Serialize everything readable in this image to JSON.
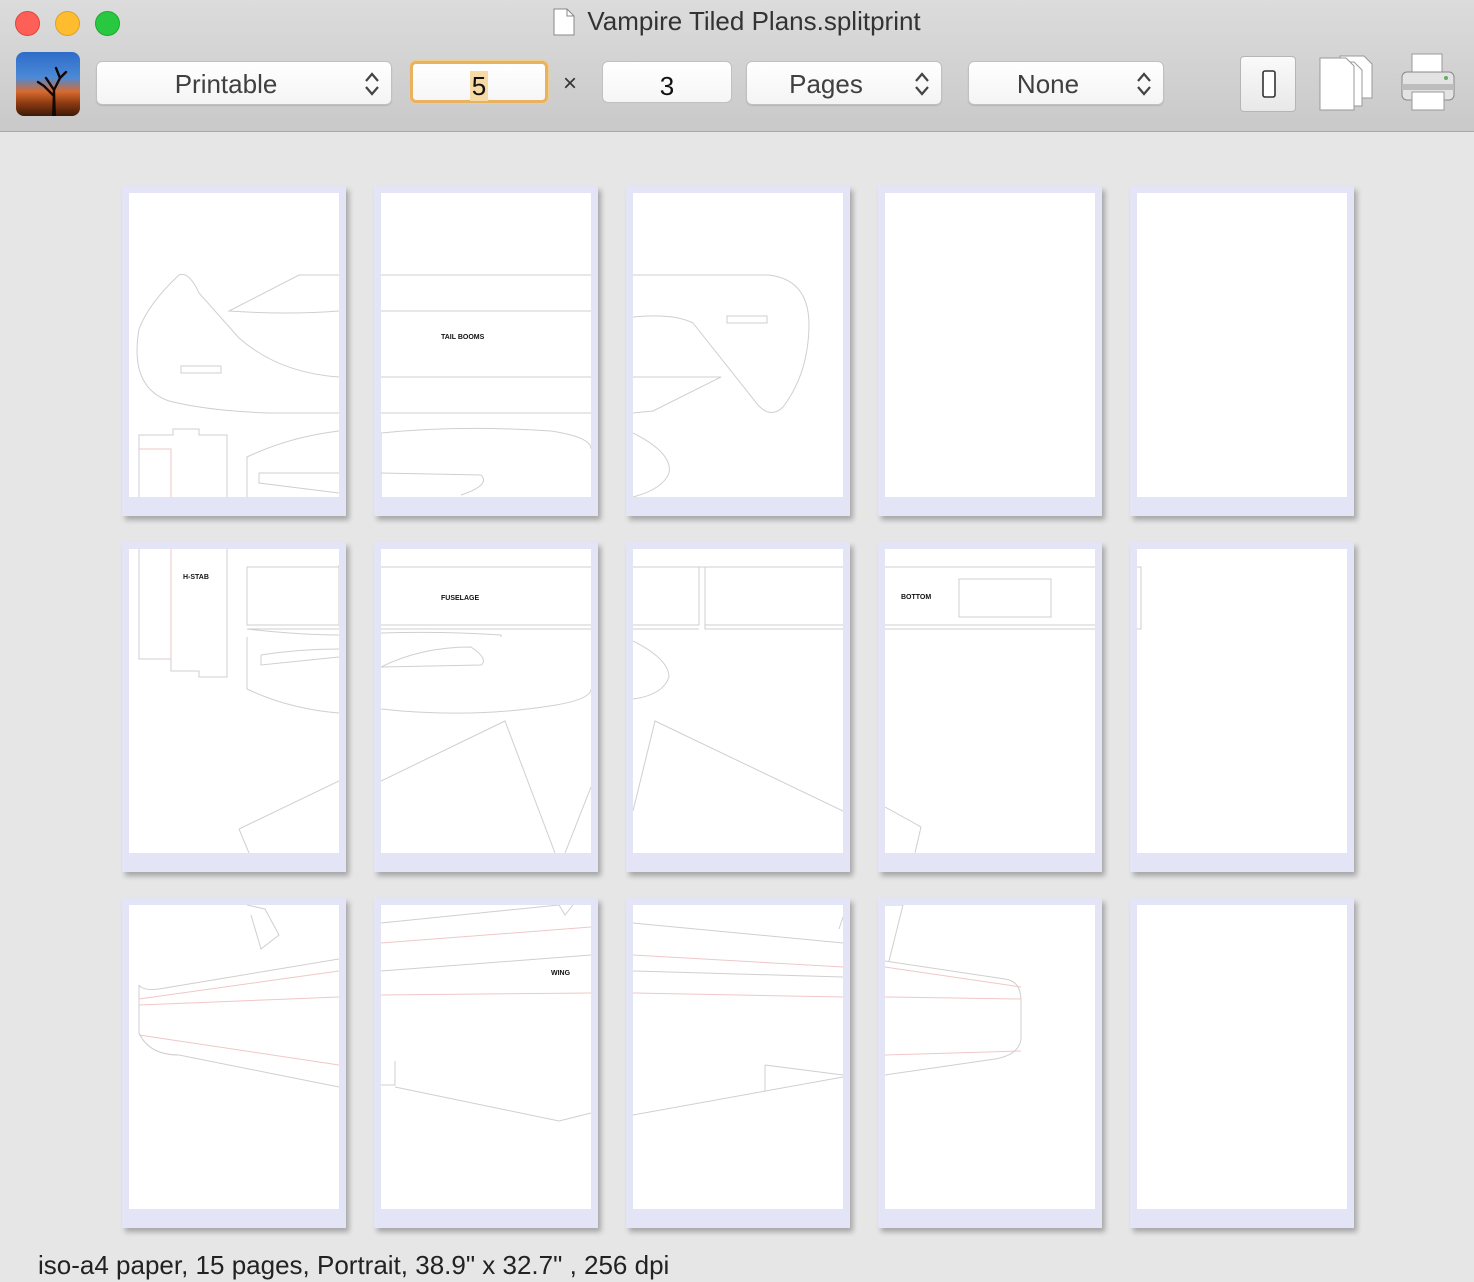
{
  "window": {
    "title": "Vampire Tiled Plans.splitprint"
  },
  "toolbar": {
    "scale_mode": "Printable",
    "columns": "5",
    "times_symbol": "×",
    "rows": "3",
    "unit_mode": "Pages",
    "overlap_mode": "None",
    "icons": [
      "app-icon",
      "portrait-orientation-icon",
      "pages-stack-icon",
      "printer-icon"
    ]
  },
  "grid": {
    "columns": 5,
    "rows": 3,
    "labels": {
      "tail_booms": "TAIL BOOMS",
      "h_stab": "H-STAB",
      "fuselage": "FUSELAGE",
      "bottom": "BOTTOM",
      "wing": "WING"
    }
  },
  "status": {
    "text": "iso-a4 paper, 15 pages, Portrait, 38.9\" x 32.7\" , 256 dpi"
  },
  "colors": {
    "page_border": "#e4e4f7",
    "outline": "#cfcfcf",
    "guide": "#f0c7c7"
  }
}
